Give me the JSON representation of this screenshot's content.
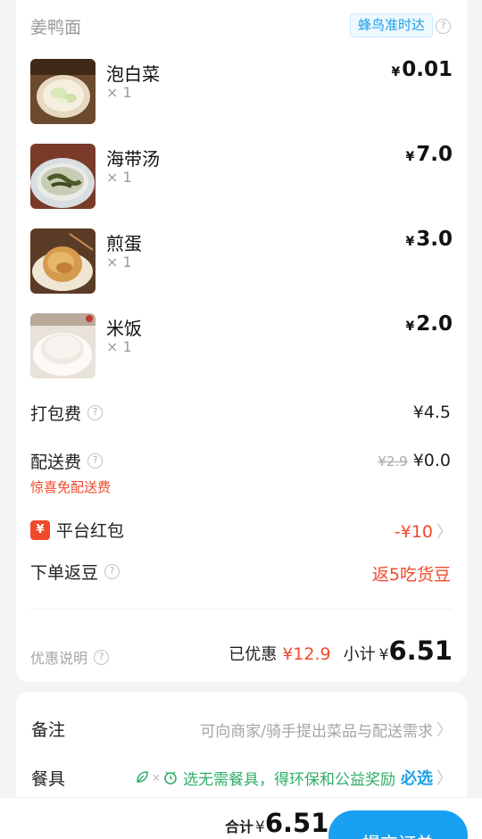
{
  "shop": {
    "name": "姜鸭面",
    "delivery_badge": "蜂鸟准时达"
  },
  "items": [
    {
      "name": "泡白菜",
      "qty": "× 1",
      "price": "0.01",
      "thumb": "pickled-cabbage-photo"
    },
    {
      "name": "海带汤",
      "qty": "× 1",
      "price": "7.0",
      "thumb": "seaweed-soup-photo"
    },
    {
      "name": "煎蛋",
      "qty": "× 1",
      "price": "3.0",
      "thumb": "fried-egg-photo"
    },
    {
      "name": "米饭",
      "qty": "× 1",
      "price": "2.0",
      "thumb": "rice-photo"
    }
  ],
  "currency": "¥",
  "fees": {
    "packaging": {
      "label": "打包费",
      "value": "¥4.5"
    },
    "delivery": {
      "label": "配送费",
      "original": "¥2.9",
      "value": "¥0.0",
      "note": "惊喜免配送费"
    }
  },
  "red_packet": {
    "label": "平台红包",
    "value": "-¥10",
    "icon": "¥"
  },
  "beans": {
    "label": "下单返豆",
    "value": "返5吃货豆"
  },
  "summary": {
    "discount_label": "优惠说明",
    "saved_label": "已优惠",
    "saved_value": "¥12.9",
    "subtotal_label": "小计",
    "subtotal_yen": "¥",
    "subtotal_value": "6.51"
  },
  "remark": {
    "label": "备注",
    "placeholder": "可向商家/骑手提出菜品与配送需求"
  },
  "tableware": {
    "label": "餐具",
    "prompt": "选无需餐具，得环保和公益奖励",
    "action": "必选"
  },
  "bottom": {
    "total_label": "合计",
    "total_yen": "¥",
    "total_value": "6.51",
    "submit_label": "提交订单"
  },
  "colors": {
    "accent": "#1aa0f0",
    "discount": "#f04a2c",
    "eco": "#2fae69"
  }
}
